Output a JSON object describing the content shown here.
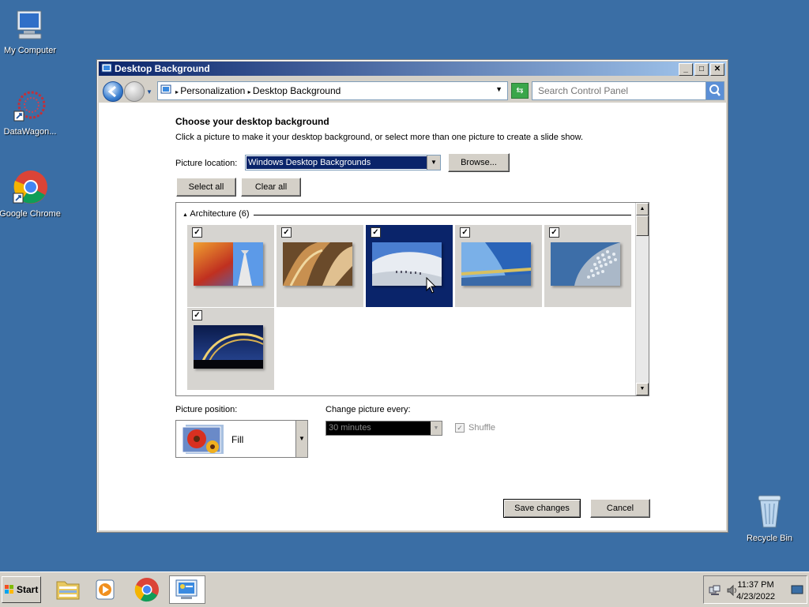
{
  "desktop": {
    "icons": [
      {
        "label": "My Computer"
      },
      {
        "label": "DataWagon..."
      },
      {
        "label": "Google Chrome"
      },
      {
        "label": "Recycle Bin"
      }
    ]
  },
  "window": {
    "title": "Desktop Background",
    "controls": {
      "minimize": "_",
      "maximize": "□",
      "close": "✕"
    }
  },
  "navbar": {
    "breadcrumb": [
      "Personalization",
      "Desktop Background"
    ],
    "search_placeholder": "Search Control Panel"
  },
  "content": {
    "heading": "Choose your desktop background",
    "description": "Click a picture to make it your desktop background, or select more than one picture to create a slide show.",
    "picture_location_label": "Picture location:",
    "picture_location_value": "Windows Desktop Backgrounds",
    "browse_label": "Browse...",
    "select_all_label": "Select all",
    "clear_all_label": "Clear all",
    "gallery": {
      "group_label": "Architecture (6)",
      "thumbnails": [
        {
          "checked": true,
          "selected": false
        },
        {
          "checked": true,
          "selected": false
        },
        {
          "checked": true,
          "selected": true
        },
        {
          "checked": true,
          "selected": false
        },
        {
          "checked": true,
          "selected": false
        },
        {
          "checked": true,
          "selected": false
        }
      ]
    },
    "picture_position_label": "Picture position:",
    "picture_position_value": "Fill",
    "change_picture_label": "Change picture every:",
    "change_picture_value": "30 minutes",
    "shuffle_label": "Shuffle",
    "shuffle_checked": true,
    "save_label": "Save changes",
    "cancel_label": "Cancel"
  },
  "taskbar": {
    "start_label": "Start",
    "clock_time": "11:37 PM",
    "clock_date": "4/23/2022"
  },
  "colors": {
    "desktop": "#3a6ea5",
    "titlebar": "#0a246a",
    "selection": "#0a246a"
  }
}
